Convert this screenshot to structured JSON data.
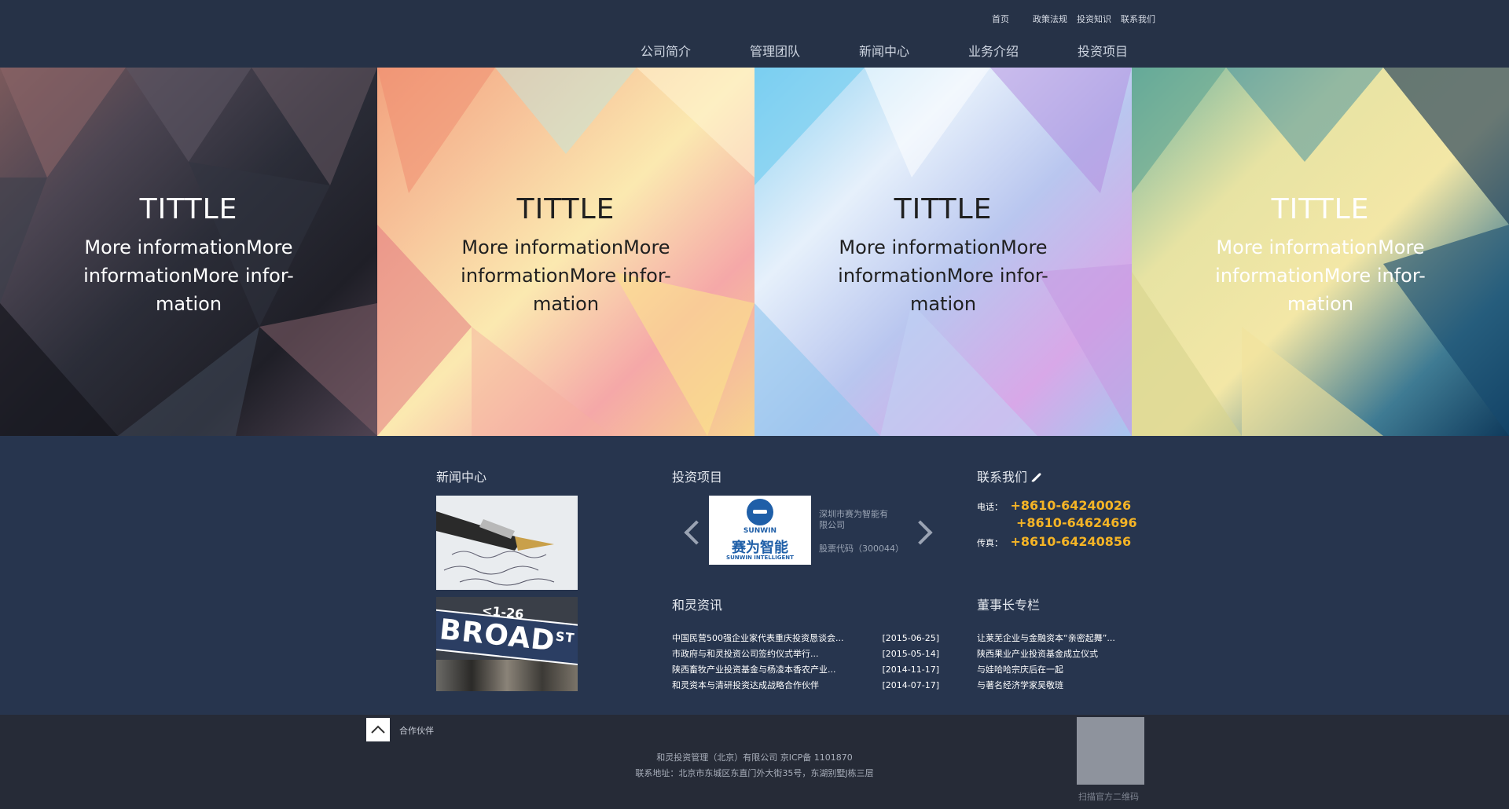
{
  "top_links": [
    "首页",
    "政策法规",
    "投资知识",
    "联系我们"
  ],
  "main_nav": [
    "公司简介",
    "管理团队",
    "新闻中心",
    "业务介绍",
    "投资项目"
  ],
  "hero_panels": [
    {
      "title": "TITTLE",
      "info": "More informationMore informationMore infor-mation"
    },
    {
      "title": "TITTLE",
      "info": "More informationMore informationMore infor-mation"
    },
    {
      "title": "TITTLE",
      "info": "More informationMore informationMore infor-mation"
    },
    {
      "title": "TITTLE",
      "info": "More informationMore informationMore infor-mation"
    }
  ],
  "sections": {
    "news_center": "新闻中心",
    "investment": "投资项目",
    "contact": "联系我们",
    "heling_news": "和灵资讯",
    "chairman_column": "董事长专栏"
  },
  "investment_item": {
    "logo_en": "SUNWIN",
    "logo_cn": "赛为智能",
    "logo_sub": "SUNWIN INTELLIGENT",
    "name": "深圳市赛为智能有限公司",
    "code": "股票代码（300044）"
  },
  "news_images": {
    "street_sign": "BROAD",
    "street_sign_sup": "ST",
    "street_sign_num": "<1-26"
  },
  "contact": {
    "tel_label": "电话：",
    "tel1": "+8610-64240026",
    "tel2": "+8610-64624696",
    "fax_label": "传真：",
    "fax": "+8610-64240856"
  },
  "heling_news": [
    {
      "title": "中国民营500强企业家代表重庆投资恳谈会...",
      "date": "[2015-06-25]"
    },
    {
      "title": "市政府与和灵投资公司签约仪式举行...",
      "date": "[2015-05-14]"
    },
    {
      "title": "陕西畜牧产业投资基金与杨凌本香农产业...",
      "date": "[2014-11-17]"
    },
    {
      "title": "和灵资本与清研投资达成战略合作伙伴",
      "date": "[2014-07-17]"
    }
  ],
  "chairman_column": [
    "让莱芜企业与金融资本“亲密起舞”...",
    "陕西果业产业投资基金成立仪式",
    "与娃哈哈宗庆后在一起",
    "与著名经济学家吴敬琏"
  ],
  "footer": {
    "partner": "合作伙伴",
    "copyright": "和灵投资管理（北京）有限公司 京ICP备 1101870",
    "address": "联系地址：北京市东城区东直门外大街35号，东湖别墅J栋三层",
    "qr_label": "扫描官方二维码"
  },
  "colors": {
    "background": "#27354e",
    "header": "#263247",
    "footer": "#262b37",
    "phone": "#f5b426"
  }
}
